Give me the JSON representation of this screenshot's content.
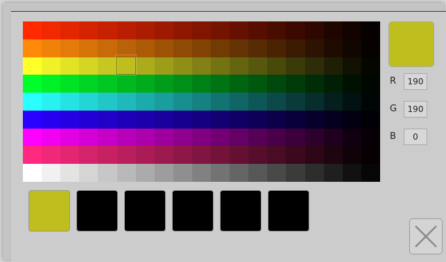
{
  "palette": {
    "rows": [
      [
        "#ff2a00",
        "#f12800",
        "#e32500",
        "#d52300",
        "#c72100",
        "#b91e00",
        "#ab1c00",
        "#9d1a00",
        "#8f1700",
        "#811500",
        "#731300",
        "#651000",
        "#570e00",
        "#490c00",
        "#3b0900",
        "#2d0700",
        "#1f0500",
        "#110200",
        "#060000"
      ],
      [
        "#ff8a0a",
        "#f18209",
        "#e37a09",
        "#d57208",
        "#c76a07",
        "#b96207",
        "#ab5a06",
        "#9d5206",
        "#8f4a05",
        "#814204",
        "#733b04",
        "#653303",
        "#572b03",
        "#492302",
        "#3b1b01",
        "#2d1301",
        "#1f0b00",
        "#110600",
        "#060200"
      ],
      [
        "#ffff2a",
        "#f1f128",
        "#e3e325",
        "#d5d523",
        "#c7c721",
        "#bebe1e",
        "#abab1c",
        "#9d9d1a",
        "#8f8f17",
        "#818115",
        "#737313",
        "#656510",
        "#57570e",
        "#49490c",
        "#3b3b09",
        "#2d2d07",
        "#1f1f05",
        "#111102",
        "#060600"
      ],
      [
        "#00ff2a",
        "#00f128",
        "#00e325",
        "#00d523",
        "#00c721",
        "#00b91e",
        "#00ab1c",
        "#009d1a",
        "#008f17",
        "#008115",
        "#007313",
        "#006510",
        "#00570e",
        "#00490c",
        "#003b09",
        "#002d07",
        "#001f05",
        "#001102",
        "#000600"
      ],
      [
        "#2affff",
        "#28f1f1",
        "#25e3e3",
        "#23d5d5",
        "#21c7c7",
        "#1eb9b9",
        "#1cabab",
        "#1a9d9d",
        "#178f8f",
        "#158181",
        "#137373",
        "#106565",
        "#0e5757",
        "#0c4949",
        "#093b3b",
        "#072d2d",
        "#051f1f",
        "#021111",
        "#000606"
      ],
      [
        "#2a00ff",
        "#2800f1",
        "#2500e3",
        "#2300d5",
        "#2100c7",
        "#1e00b9",
        "#1c00ab",
        "#1a009d",
        "#17008f",
        "#150081",
        "#130073",
        "#100065",
        "#0e0057",
        "#0c0049",
        "#09003b",
        "#07002d",
        "#05001f",
        "#020011",
        "#000006"
      ],
      [
        "#ff00ff",
        "#f100f1",
        "#e300e3",
        "#d500d5",
        "#c700c7",
        "#b900b9",
        "#ab00ab",
        "#9d009d",
        "#8f008f",
        "#810081",
        "#730073",
        "#650065",
        "#570057",
        "#490049",
        "#3b003b",
        "#2d002d",
        "#1f001f",
        "#110011",
        "#060006"
      ],
      [
        "#ff2a80",
        "#f12879",
        "#e32572",
        "#d5236b",
        "#c72164",
        "#b91e5d",
        "#ab1c56",
        "#9d1a4f",
        "#8f1748",
        "#811541",
        "#73133a",
        "#651033",
        "#570e2c",
        "#490c25",
        "#3b091e",
        "#2d0717",
        "#1f0510",
        "#110209",
        "#060003"
      ],
      [
        "#ffffff",
        "#f1f1f1",
        "#e3e3e3",
        "#d5d5d5",
        "#c7c7c7",
        "#b9b9b9",
        "#ababab",
        "#9d9d9d",
        "#8f8f8f",
        "#818181",
        "#737373",
        "#656565",
        "#575757",
        "#494949",
        "#3b3b3b",
        "#2d2d2d",
        "#1f1f1f",
        "#111111",
        "#060606"
      ]
    ],
    "selected_color": "#bebe1e"
  },
  "recent_swatches": [
    "#bebe1e",
    "#000000",
    "#000000",
    "#000000",
    "#000000",
    "#000000"
  ],
  "preview_color": "#bebe1e",
  "channels": [
    {
      "label": "R",
      "value": "190"
    },
    {
      "label": "G",
      "value": "190"
    },
    {
      "label": "B",
      "value": "0"
    }
  ],
  "close_icon": "close-icon"
}
